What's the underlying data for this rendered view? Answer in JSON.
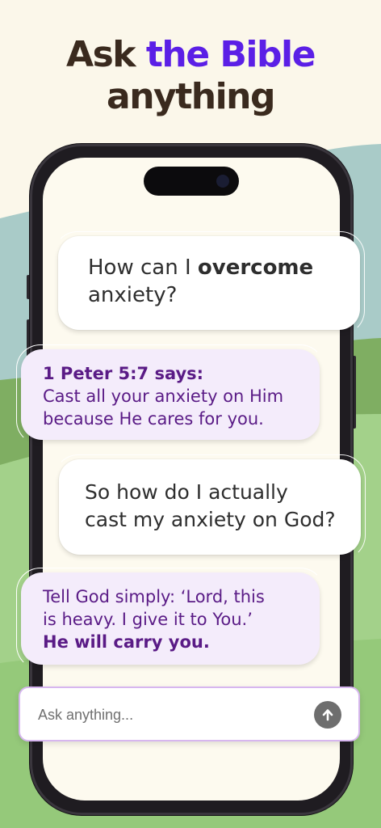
{
  "headline": {
    "line1_plain": "Ask ",
    "line1_accent": "the Bible",
    "line2": "anything"
  },
  "chat": {
    "user1": {
      "text_plain": "How can I ",
      "text_bold": "overcome",
      "text_end": "anxiety?"
    },
    "bot1": {
      "title": "1 Peter 5:7 says:",
      "body": "Cast all your anxiety on Him because He cares for you."
    },
    "user2": {
      "line1": "So how do I actually",
      "line2": "cast my anxiety on God?"
    },
    "bot2": {
      "line1": "Tell God simply: ‘Lord, this",
      "line2": "is heavy. I give it to You.’",
      "bold": "He will carry you."
    }
  },
  "input": {
    "placeholder": "Ask anything..."
  },
  "icons": {
    "send": "arrow-up-icon"
  },
  "colors": {
    "accent": "#5b1fe6",
    "bot_text": "#5a1b86",
    "headline": "#3a2a1e"
  }
}
